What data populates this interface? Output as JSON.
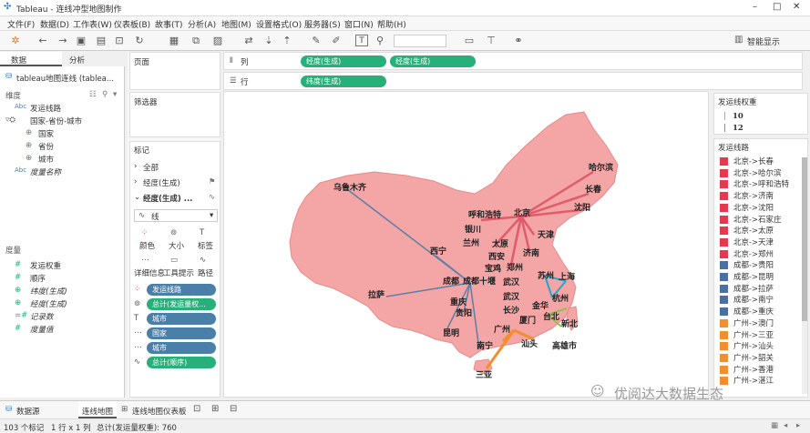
{
  "window": {
    "title": "Tableau - 连线冲型地图制作"
  },
  "menu": [
    "文件(F)",
    "数据(D)",
    "工作表(W)",
    "仪表板(B)",
    "故事(T)",
    "分析(A)",
    "地图(M)",
    "设置格式(O)",
    "服务器(S)",
    "窗口(N)",
    "帮助(H)"
  ],
  "toolbar": {
    "show_me": "智能显示"
  },
  "left": {
    "tabs": [
      "数据",
      "分析"
    ],
    "datasource": "tableau地图连线 (tablea...",
    "dim_header": "维度",
    "dimensions": [
      "发运线路",
      "国家-省份-城市",
      "国家",
      "省份",
      "城市",
      "度量名称"
    ],
    "measure_header": "度量",
    "measures": [
      "发运权重",
      "顺序",
      "纬度(生成)",
      "经度(生成)",
      "记录数",
      "度量值"
    ]
  },
  "middle": {
    "pages": "页面",
    "filters": "筛选器",
    "marks": "标记",
    "all": "全部",
    "lat_gen": "经度(生成)",
    "lon_gen": "经度(生成) ...",
    "marktype": "线",
    "cards": [
      "颜色",
      "大小",
      "标签",
      "详细信息",
      "工具提示",
      "路径"
    ],
    "pills": [
      "发运线路",
      "总计(发运量权...",
      "城市",
      "国家",
      "城市",
      "总计(顺序)"
    ]
  },
  "shelves": {
    "columns_label": "列",
    "rows_label": "行",
    "col_pills": [
      "经度(生成)",
      "经度(生成)"
    ],
    "row_pills": [
      "纬度(生成)"
    ]
  },
  "map_labels": [
    "乌鲁木齐",
    "哈尔滨",
    "长春",
    "沈阳",
    "呼和浩特",
    "北京",
    "银川",
    "天津",
    "兰州",
    "太原",
    "西宁",
    "西安",
    "济南",
    "宝鸡",
    "郑州",
    "上海",
    "苏州",
    "成都",
    "成都十堰",
    "武汉",
    "拉萨",
    "重庆",
    "武汉",
    "杭州",
    "贵阳",
    "长沙",
    "金华",
    "昆明",
    "厦门",
    "台北",
    "广州",
    "新北",
    "南宁",
    "汕头",
    "高雄市",
    "三亚"
  ],
  "size_legend": {
    "title": "发运线权重",
    "values": [
      "10",
      "12"
    ]
  },
  "route_legend": {
    "title": "发运线路",
    "items": [
      {
        "label": "北京->长春",
        "color": "#e8384f"
      },
      {
        "label": "北京->哈尔滨",
        "color": "#e8384f"
      },
      {
        "label": "北京->呼和浩特",
        "color": "#e8384f"
      },
      {
        "label": "北京->济南",
        "color": "#e8384f"
      },
      {
        "label": "北京->沈阳",
        "color": "#e8384f"
      },
      {
        "label": "北京->石家庄",
        "color": "#e8384f"
      },
      {
        "label": "北京->太原",
        "color": "#e8384f"
      },
      {
        "label": "北京->天津",
        "color": "#e8384f"
      },
      {
        "label": "北京->郑州",
        "color": "#e8384f"
      },
      {
        "label": "成都->贵阳",
        "color": "#4a6fa5"
      },
      {
        "label": "成都->昆明",
        "color": "#4a6fa5"
      },
      {
        "label": "成都->拉萨",
        "color": "#4a6fa5"
      },
      {
        "label": "成都->南宁",
        "color": "#4a6fa5"
      },
      {
        "label": "成都->重庆",
        "color": "#4a6fa5"
      },
      {
        "label": "广州->澳门",
        "color": "#f28e2b"
      },
      {
        "label": "广州->三亚",
        "color": "#f28e2b"
      },
      {
        "label": "广州->汕头",
        "color": "#f28e2b"
      },
      {
        "label": "广州->韶关",
        "color": "#f28e2b"
      },
      {
        "label": "广州->香港",
        "color": "#f28e2b"
      },
      {
        "label": "广州->湛江",
        "color": "#f28e2b"
      }
    ]
  },
  "tabs_bottom": [
    "数据源",
    "连线地图",
    "连线地图仪表板"
  ],
  "status": {
    "marks": "103 个标记",
    "rows": "1 行 x 1 列",
    "sum": "总计(发运量权重): 760"
  },
  "watermark": "优阅达大数据生态"
}
